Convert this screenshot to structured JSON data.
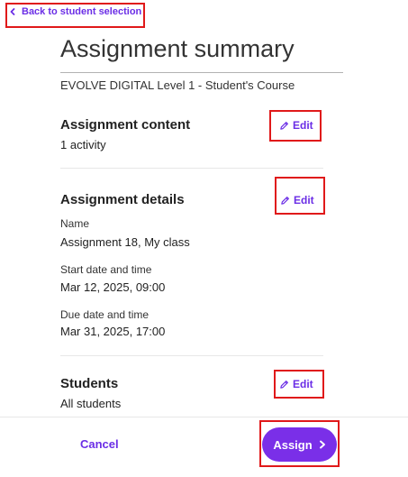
{
  "nav": {
    "back_label": "Back to student selection",
    "back_icon": "chevron-left-icon"
  },
  "header": {
    "title": "Assignment summary",
    "course": "EVOLVE DIGITAL Level 1 - Student's Course"
  },
  "sections": {
    "content": {
      "title": "Assignment content",
      "value": "1 activity",
      "edit_label": "Edit"
    },
    "details": {
      "title": "Assignment details",
      "edit_label": "Edit",
      "name_label": "Name",
      "name_value": "Assignment 18, My class",
      "start_label": "Start date and time",
      "start_value": "Mar 12, 2025, 09:00",
      "due_label": "Due date and time",
      "due_value": "Mar 31, 2025, 17:00"
    },
    "students": {
      "title": "Students",
      "value": "All students",
      "edit_label": "Edit"
    }
  },
  "footer": {
    "cancel_label": "Cancel",
    "assign_label": "Assign",
    "assign_icon": "chevron-right-icon"
  },
  "colors": {
    "accent": "#6b2ee6",
    "primary_button": "#7a2fe8",
    "highlight_border": "#e0191a"
  }
}
